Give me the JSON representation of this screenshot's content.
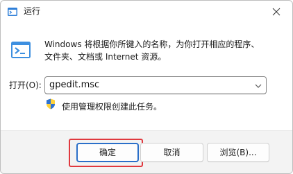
{
  "window": {
    "title": "运行",
    "title_icon": "run-dialog-icon",
    "close_icon": "close-icon"
  },
  "description": {
    "line1": "Windows 将根据你所键入的名称，为你打开相应的程序、",
    "line2": "文件夹、文档或 Internet 资源。"
  },
  "open_field": {
    "label": "打开(O):",
    "value": "gpedit.msc",
    "dropdown_icon": "chevron-down-icon"
  },
  "admin_note": {
    "icon": "uac-shield-icon",
    "text": "使用管理权限创建此任务。"
  },
  "buttons": {
    "ok_label": "确定",
    "cancel_label": "取消",
    "browse_label": "浏览(B)..."
  },
  "colors": {
    "accent": "#2a6fc9",
    "highlight": "#e0383e",
    "footer_bg": "#f3f3f3"
  }
}
